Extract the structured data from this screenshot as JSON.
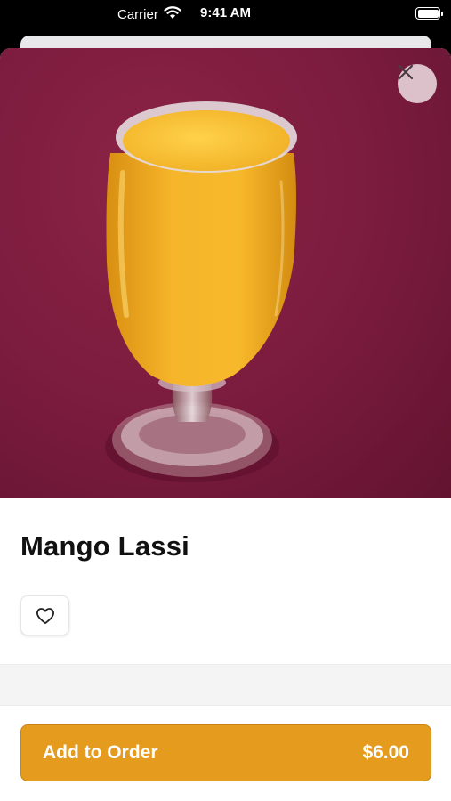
{
  "status_bar": {
    "carrier": "Carrier",
    "time": "9:41 AM"
  },
  "product": {
    "name": "Mango Lassi",
    "image_alt": "Mango lassi in stemmed glass"
  },
  "actions": {
    "add_label": "Add to Order",
    "price": "$6.00"
  },
  "icons": {
    "wifi": "wifi-icon",
    "battery": "battery-icon",
    "close": "close-icon",
    "favorite": "heart-icon"
  },
  "colors": {
    "accent": "#e59b1d",
    "hero_background": "#7a1b3d",
    "drink": "#f5b428"
  }
}
